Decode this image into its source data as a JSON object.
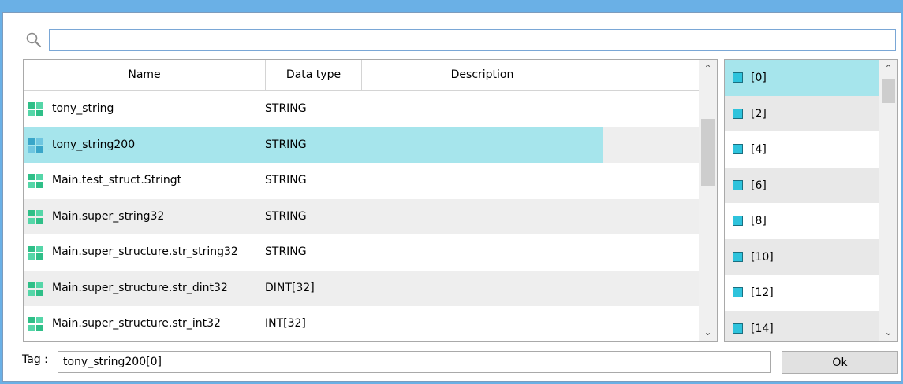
{
  "search": {
    "value": "",
    "placeholder": ""
  },
  "grid": {
    "columns": [
      "Name",
      "Data type",
      "Description"
    ],
    "rows": [
      {
        "name": "tony_string",
        "type": "STRING",
        "selected": false
      },
      {
        "name": "tony_string200",
        "type": "STRING",
        "selected": true
      },
      {
        "name": "Main.test_struct.Stringt",
        "type": "STRING",
        "selected": false
      },
      {
        "name": "Main.super_string32",
        "type": "STRING",
        "selected": false
      },
      {
        "name": "Main.super_structure.str_string32",
        "type": "STRING",
        "selected": false
      },
      {
        "name": "Main.super_structure.str_dint32",
        "type": "DINT[32]",
        "selected": false
      },
      {
        "name": "Main.super_structure.str_int32",
        "type": "INT[32]",
        "selected": false
      }
    ]
  },
  "index_list": {
    "items": [
      "[0]",
      "[2]",
      "[4]",
      "[6]",
      "[8]",
      "[10]",
      "[12]",
      "[14]"
    ],
    "selected_index": 0
  },
  "tag": {
    "label": "Tag :",
    "value": "tony_string200[0]"
  },
  "ok_label": "Ok",
  "colors": {
    "selection": "#a6e5ec",
    "row_alt": "#eeeeee",
    "icon_teal": "#2ec3dc",
    "window_border": "#6ab0e6"
  },
  "icons": {
    "search": "search-icon",
    "variable": "variable-grid-icon",
    "index": "index-square-icon"
  }
}
